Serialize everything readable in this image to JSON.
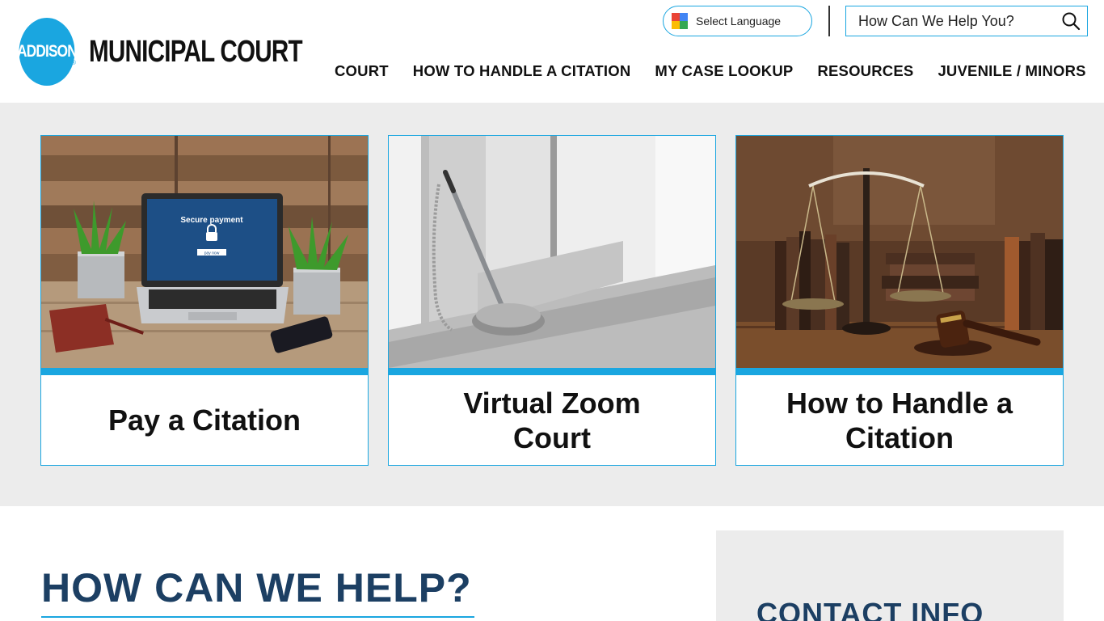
{
  "header": {
    "logo_badge": "ADDISON",
    "logo_text": "MUNICIPAL COURT",
    "logo_reg": "®",
    "language_label": "Select Language",
    "search_placeholder": "How Can We Help You?",
    "nav": [
      "COURT",
      "HOW TO HANDLE A CITATION",
      "MY CASE LOOKUP",
      "RESOURCES",
      "JUVENILE / MINORS"
    ]
  },
  "cards": [
    {
      "title": "Pay a Citation",
      "image": "laptop-secure-payment-photo",
      "screen_text": "Secure payment",
      "button_text": "pay now"
    },
    {
      "title": "Virtual Zoom Court",
      "image": "pen-on-desk-photo"
    },
    {
      "title": "How to Handle a Citation",
      "image": "scales-of-justice-gavel-photo"
    }
  ],
  "main": {
    "heading": "HOW CAN WE HELP?",
    "contact_heading": "CONTACT INFO"
  },
  "colors": {
    "accent": "#1aa6e0",
    "heading": "#1c3f63",
    "band": "#ececec"
  }
}
